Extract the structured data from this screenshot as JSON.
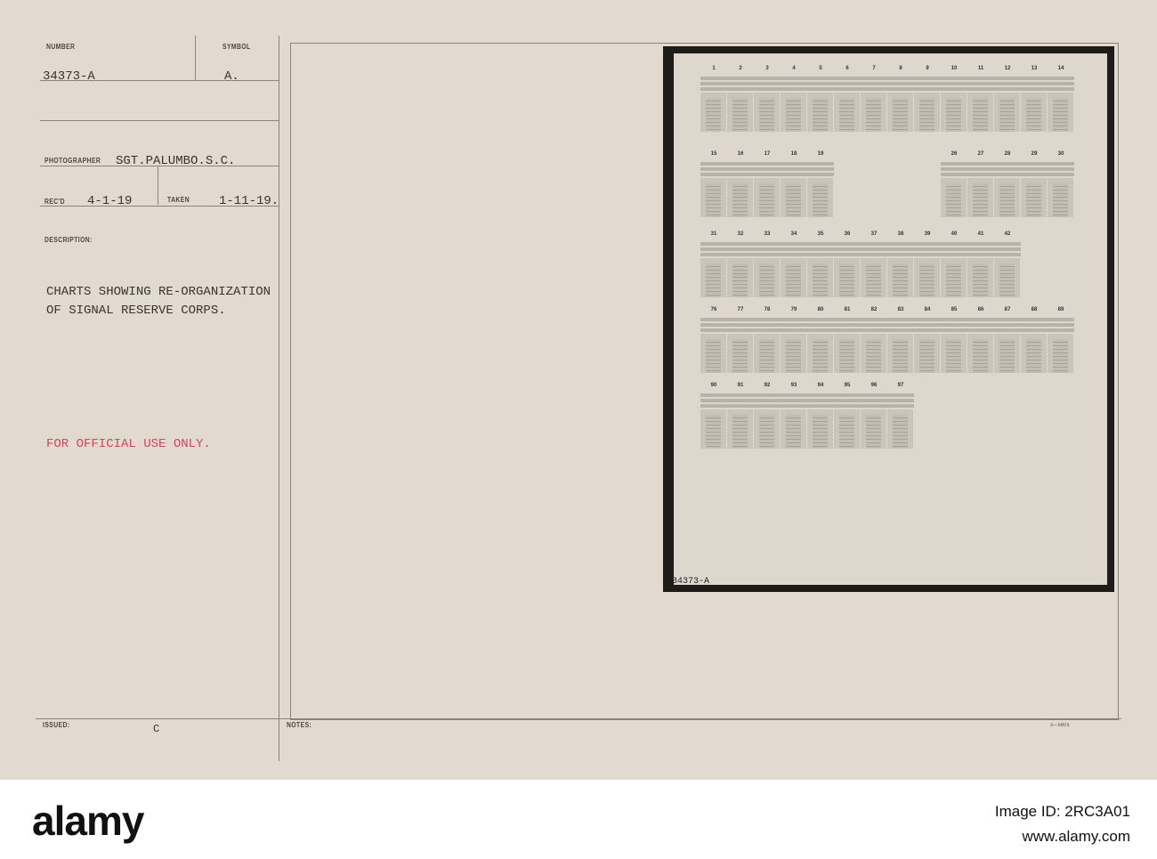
{
  "card": {
    "number_label": "NUMBER",
    "number": "34373-A",
    "symbol_label": "SYMBOL",
    "symbol": "A.",
    "photographer_label": "PHOTOGRAPHER",
    "photographer": "SGT.PALUMBO.S.C.",
    "recd_label": "REC'D",
    "recd": "4-1-19",
    "taken_label": "TAKEN",
    "taken": "1-11-19.",
    "description_label": "DESCRIPTION:",
    "description_line1": "CHARTS SHOWING RE-ORGANIZATION",
    "description_line2": "OF SIGNAL RESERVE CORPS.",
    "restriction": "FOR OFFICIAL USE ONLY.",
    "issued_label": "ISSUED:",
    "issued": "C",
    "notes_label": "NOTES:",
    "form_code": "3—5605"
  },
  "photo": {
    "rows": [
      [
        "1",
        "2",
        "3",
        "4",
        "5",
        "6",
        "7",
        "8",
        "9",
        "10",
        "11",
        "12",
        "13",
        "14"
      ],
      [
        "15",
        "16",
        "17",
        "18",
        "19",
        "",
        "",
        "",
        "",
        "26",
        "27",
        "28",
        "29",
        "30"
      ],
      [
        "31",
        "32",
        "33",
        "34",
        "35",
        "36",
        "37",
        "38",
        "39",
        "40",
        "41",
        "42"
      ],
      [
        "76",
        "77",
        "78",
        "79",
        "80",
        "81",
        "82",
        "83",
        "84",
        "85",
        "86",
        "87",
        "88",
        "89"
      ],
      [
        "90",
        "91",
        "92",
        "93",
        "94",
        "95",
        "96",
        "97"
      ]
    ],
    "negative_number": "34373-A"
  },
  "footer": {
    "brand": "alamy",
    "image_id": "Image ID: 2RC3A01",
    "url": "www.alamy.com"
  }
}
